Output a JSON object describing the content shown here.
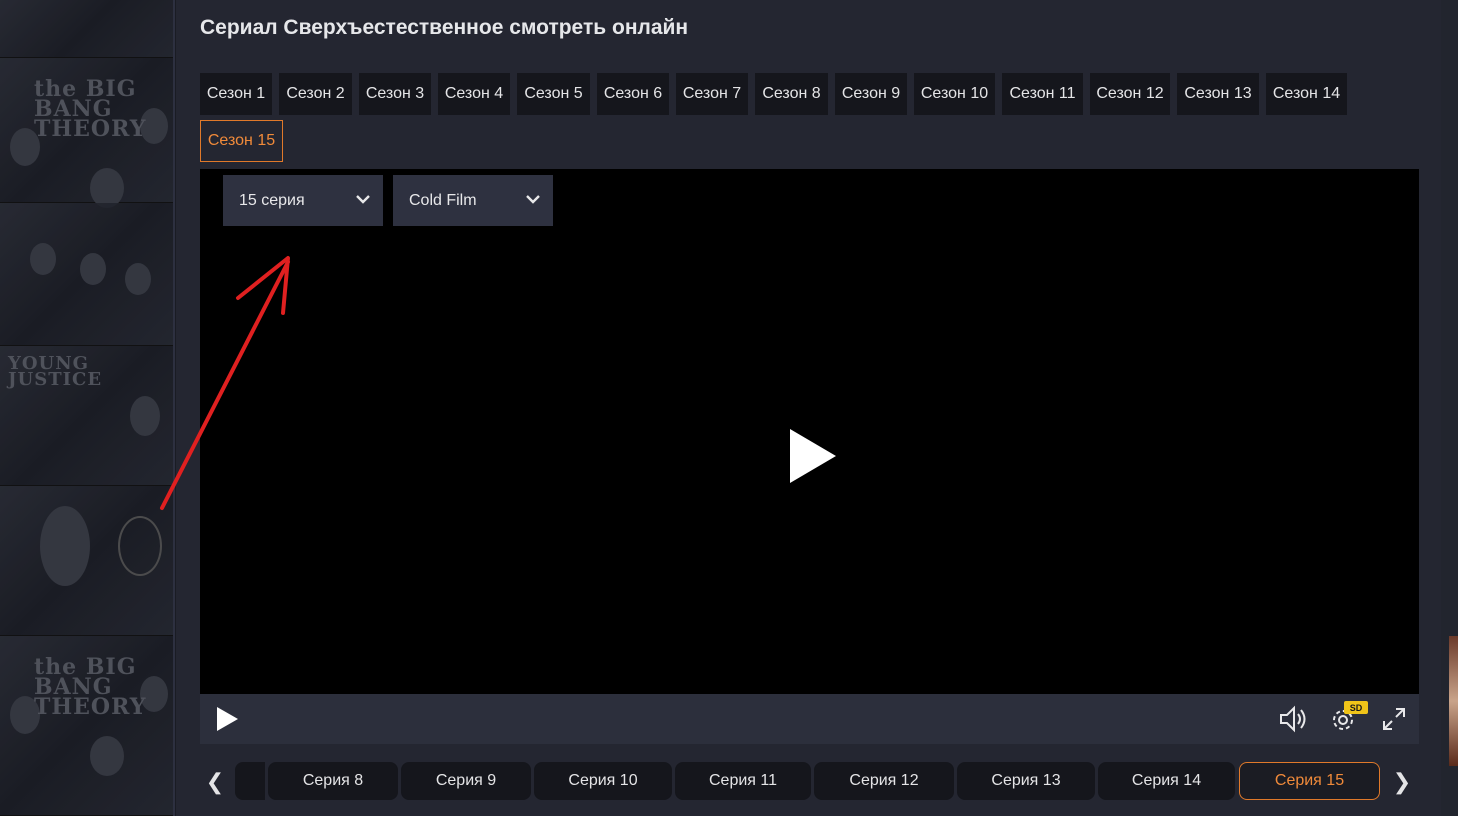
{
  "page": {
    "title": "Сериал Сверхъестественное смотреть онлайн"
  },
  "seasons": [
    {
      "label": "Сезон 1"
    },
    {
      "label": "Сезон 2"
    },
    {
      "label": "Сезон 3"
    },
    {
      "label": "Сезон 4"
    },
    {
      "label": "Сезон 5"
    },
    {
      "label": "Сезон 6"
    },
    {
      "label": "Сезон 7"
    },
    {
      "label": "Сезон 8"
    },
    {
      "label": "Сезон 9"
    },
    {
      "label": "Сезон 10"
    },
    {
      "label": "Сезон 11"
    },
    {
      "label": "Сезон 12"
    },
    {
      "label": "Сезон 13"
    },
    {
      "label": "Сезон 14"
    },
    {
      "label": "Сезон 15"
    }
  ],
  "active_season": "Сезон 15",
  "player": {
    "episode_select": "15 серия",
    "voice_select": "Cold Film",
    "quality_badge": "SD"
  },
  "episodes": [
    {
      "label": "Серия 8"
    },
    {
      "label": "Серия 9"
    },
    {
      "label": "Серия 10"
    },
    {
      "label": "Серия 11"
    },
    {
      "label": "Серия 12"
    },
    {
      "label": "Серия 13"
    },
    {
      "label": "Серия 14"
    },
    {
      "label": "Серия 15"
    }
  ],
  "active_episode": "Серия 15",
  "nav": {
    "prev": "❮",
    "next": "❯"
  },
  "left_posters": [
    {
      "text": "the BIG BANG THEORY"
    },
    {
      "text": "YOUNG JUSTICE"
    },
    {
      "text": "the BIG BANG THEORY"
    }
  ],
  "colors": {
    "accent": "#e0792a",
    "accent_text": "#f08a3a",
    "panel": "#242631",
    "tab_bg": "#15161c",
    "annotation": "#e02020"
  },
  "icons": [
    "play-icon",
    "volume-icon",
    "settings-icon",
    "fullscreen-icon",
    "chevron-down-icon",
    "chevron-left-icon",
    "chevron-right-icon"
  ]
}
